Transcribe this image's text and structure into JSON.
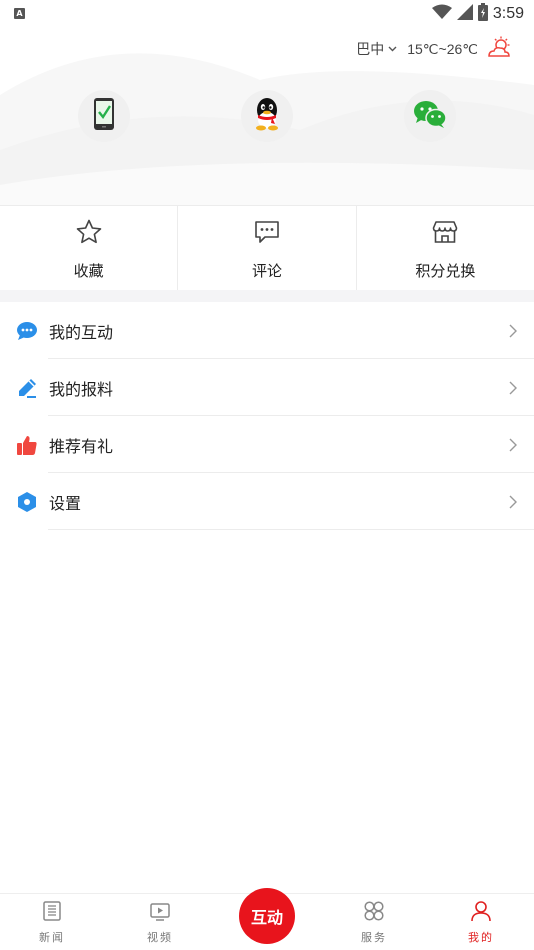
{
  "status_bar": {
    "time": "3:59",
    "notification_badge": "A",
    "icons": [
      "wifi-icon",
      "signal-icon",
      "battery-icon"
    ]
  },
  "weather": {
    "city": "巴中",
    "temperature": "15℃~26℃",
    "icon": "sun-cloud-icon"
  },
  "login_options": [
    {
      "name": "phone-login",
      "icon": "phone-icon"
    },
    {
      "name": "qq-login",
      "icon": "qq-icon"
    },
    {
      "name": "wechat-login",
      "icon": "wechat-icon"
    }
  ],
  "quick_actions": [
    {
      "label": "收藏",
      "icon": "star-icon"
    },
    {
      "label": "评论",
      "icon": "comment-icon"
    },
    {
      "label": "积分兑换",
      "icon": "store-icon"
    }
  ],
  "menu": [
    {
      "label": "我的互动",
      "icon": "chat-bubble-icon",
      "color": "#2b8fe8"
    },
    {
      "label": "我的报料",
      "icon": "pen-icon",
      "color": "#2b8fe8"
    },
    {
      "label": "推荐有礼",
      "icon": "thumbs-up-icon",
      "color": "#f0473f"
    },
    {
      "label": "设置",
      "icon": "hexagon-settings-icon",
      "color": "#2b8fe8"
    }
  ],
  "tab_bar": {
    "news": "新闻",
    "video": "视频",
    "center": "互动",
    "service": "服务",
    "mine": "我的",
    "active": "mine",
    "accent_color": "#e8141c"
  }
}
